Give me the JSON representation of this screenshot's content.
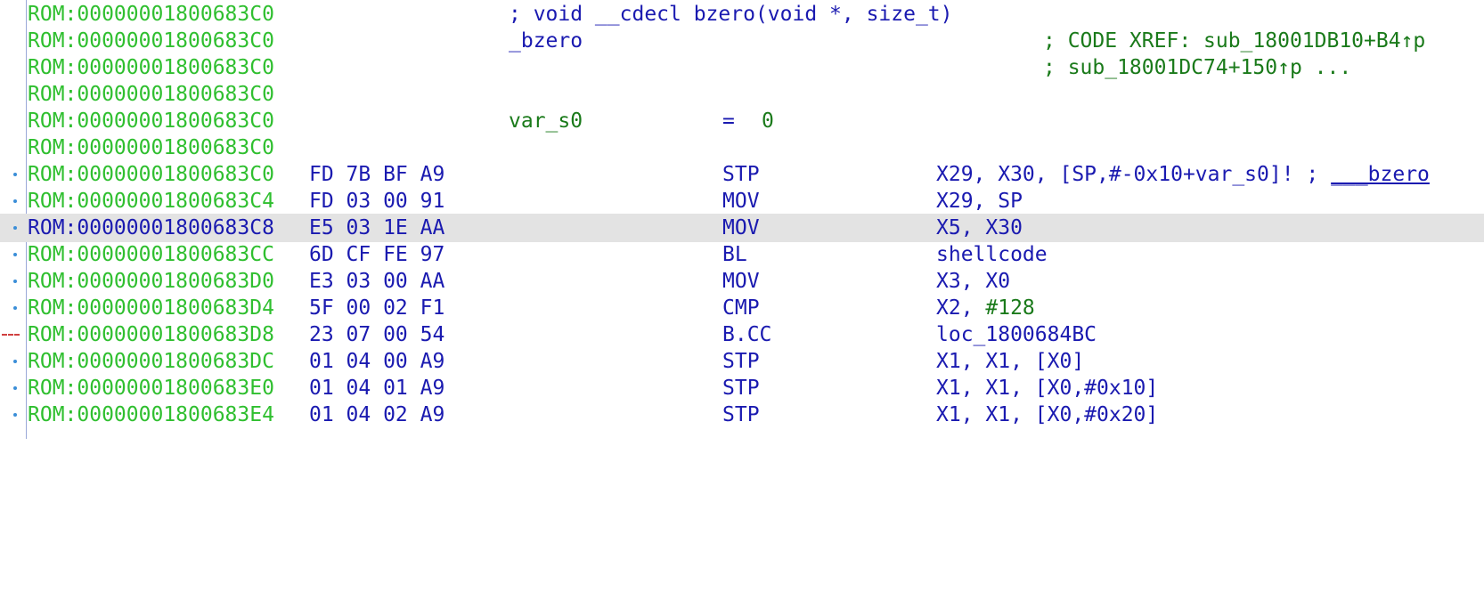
{
  "listing": {
    "rows": [
      {
        "addr": "ROM:00000001800683C0",
        "text": "; void __cdecl bzero(void *, size_t)"
      },
      {
        "addr": "ROM:00000001800683C0",
        "label": "_bzero",
        "xref": "; CODE XREF: sub_18001DB10+B4↑p"
      },
      {
        "addr": "ROM:00000001800683C0",
        "xref": "; sub_18001DC74+150↑p ..."
      },
      {
        "addr": "ROM:00000001800683C0"
      },
      {
        "addr": "ROM:00000001800683C0",
        "var": "var_s0",
        "eq": "=",
        "eqval": "0"
      },
      {
        "addr": "ROM:00000001800683C0"
      },
      {
        "addr": "ROM:00000001800683C0",
        "bytes": "FD 7B BF A9",
        "mnem": "STP",
        "ops": "X29, X30, [SP,#-0x10+var_s0]!",
        "comment": " ; ",
        "comment_ref": "___bzero"
      },
      {
        "addr": "ROM:00000001800683C4",
        "bytes": "FD 03 00 91",
        "mnem": "MOV",
        "ops": "X29, SP"
      },
      {
        "addr": "ROM:00000001800683C8",
        "bytes": "E5 03 1E AA",
        "mnem": "MOV",
        "ops": "X5, X30"
      },
      {
        "addr": "ROM:00000001800683CC",
        "bytes": "6D CF FE 97",
        "mnem": "BL",
        "ops": "shellcode"
      },
      {
        "addr": "ROM:00000001800683D0",
        "bytes": "E3 03 00 AA",
        "mnem": "MOV",
        "ops": "X3, X0"
      },
      {
        "addr": "ROM:00000001800683D4",
        "bytes": "5F 00 02 F1",
        "mnem": "CMP",
        "ops_a": "X2, ",
        "ops_num": "#128"
      },
      {
        "addr": "ROM:00000001800683D8",
        "bytes": "23 07 00 54",
        "mnem": "B.CC",
        "ops": "loc_1800684BC"
      },
      {
        "addr": "ROM:00000001800683DC",
        "bytes": "01 04 00 A9",
        "mnem": "STP",
        "ops": "X1, X1, [X0]"
      },
      {
        "addr": "ROM:00000001800683E0",
        "bytes": "01 04 01 A9",
        "mnem": "STP",
        "ops": "X1, X1, [X0,#0x10]"
      },
      {
        "addr": "ROM:00000001800683E4",
        "bytes": "01 04 02 A9",
        "mnem": "STP",
        "ops": "X1, X1, [X0,#0x20]"
      }
    ]
  },
  "colors": {
    "address_green": "#2fbf2f",
    "code_blue": "#1a1ab0",
    "comment_green": "#1a7a1a",
    "selection_gray": "#e3e3e3",
    "jump_red": "#d04040"
  }
}
